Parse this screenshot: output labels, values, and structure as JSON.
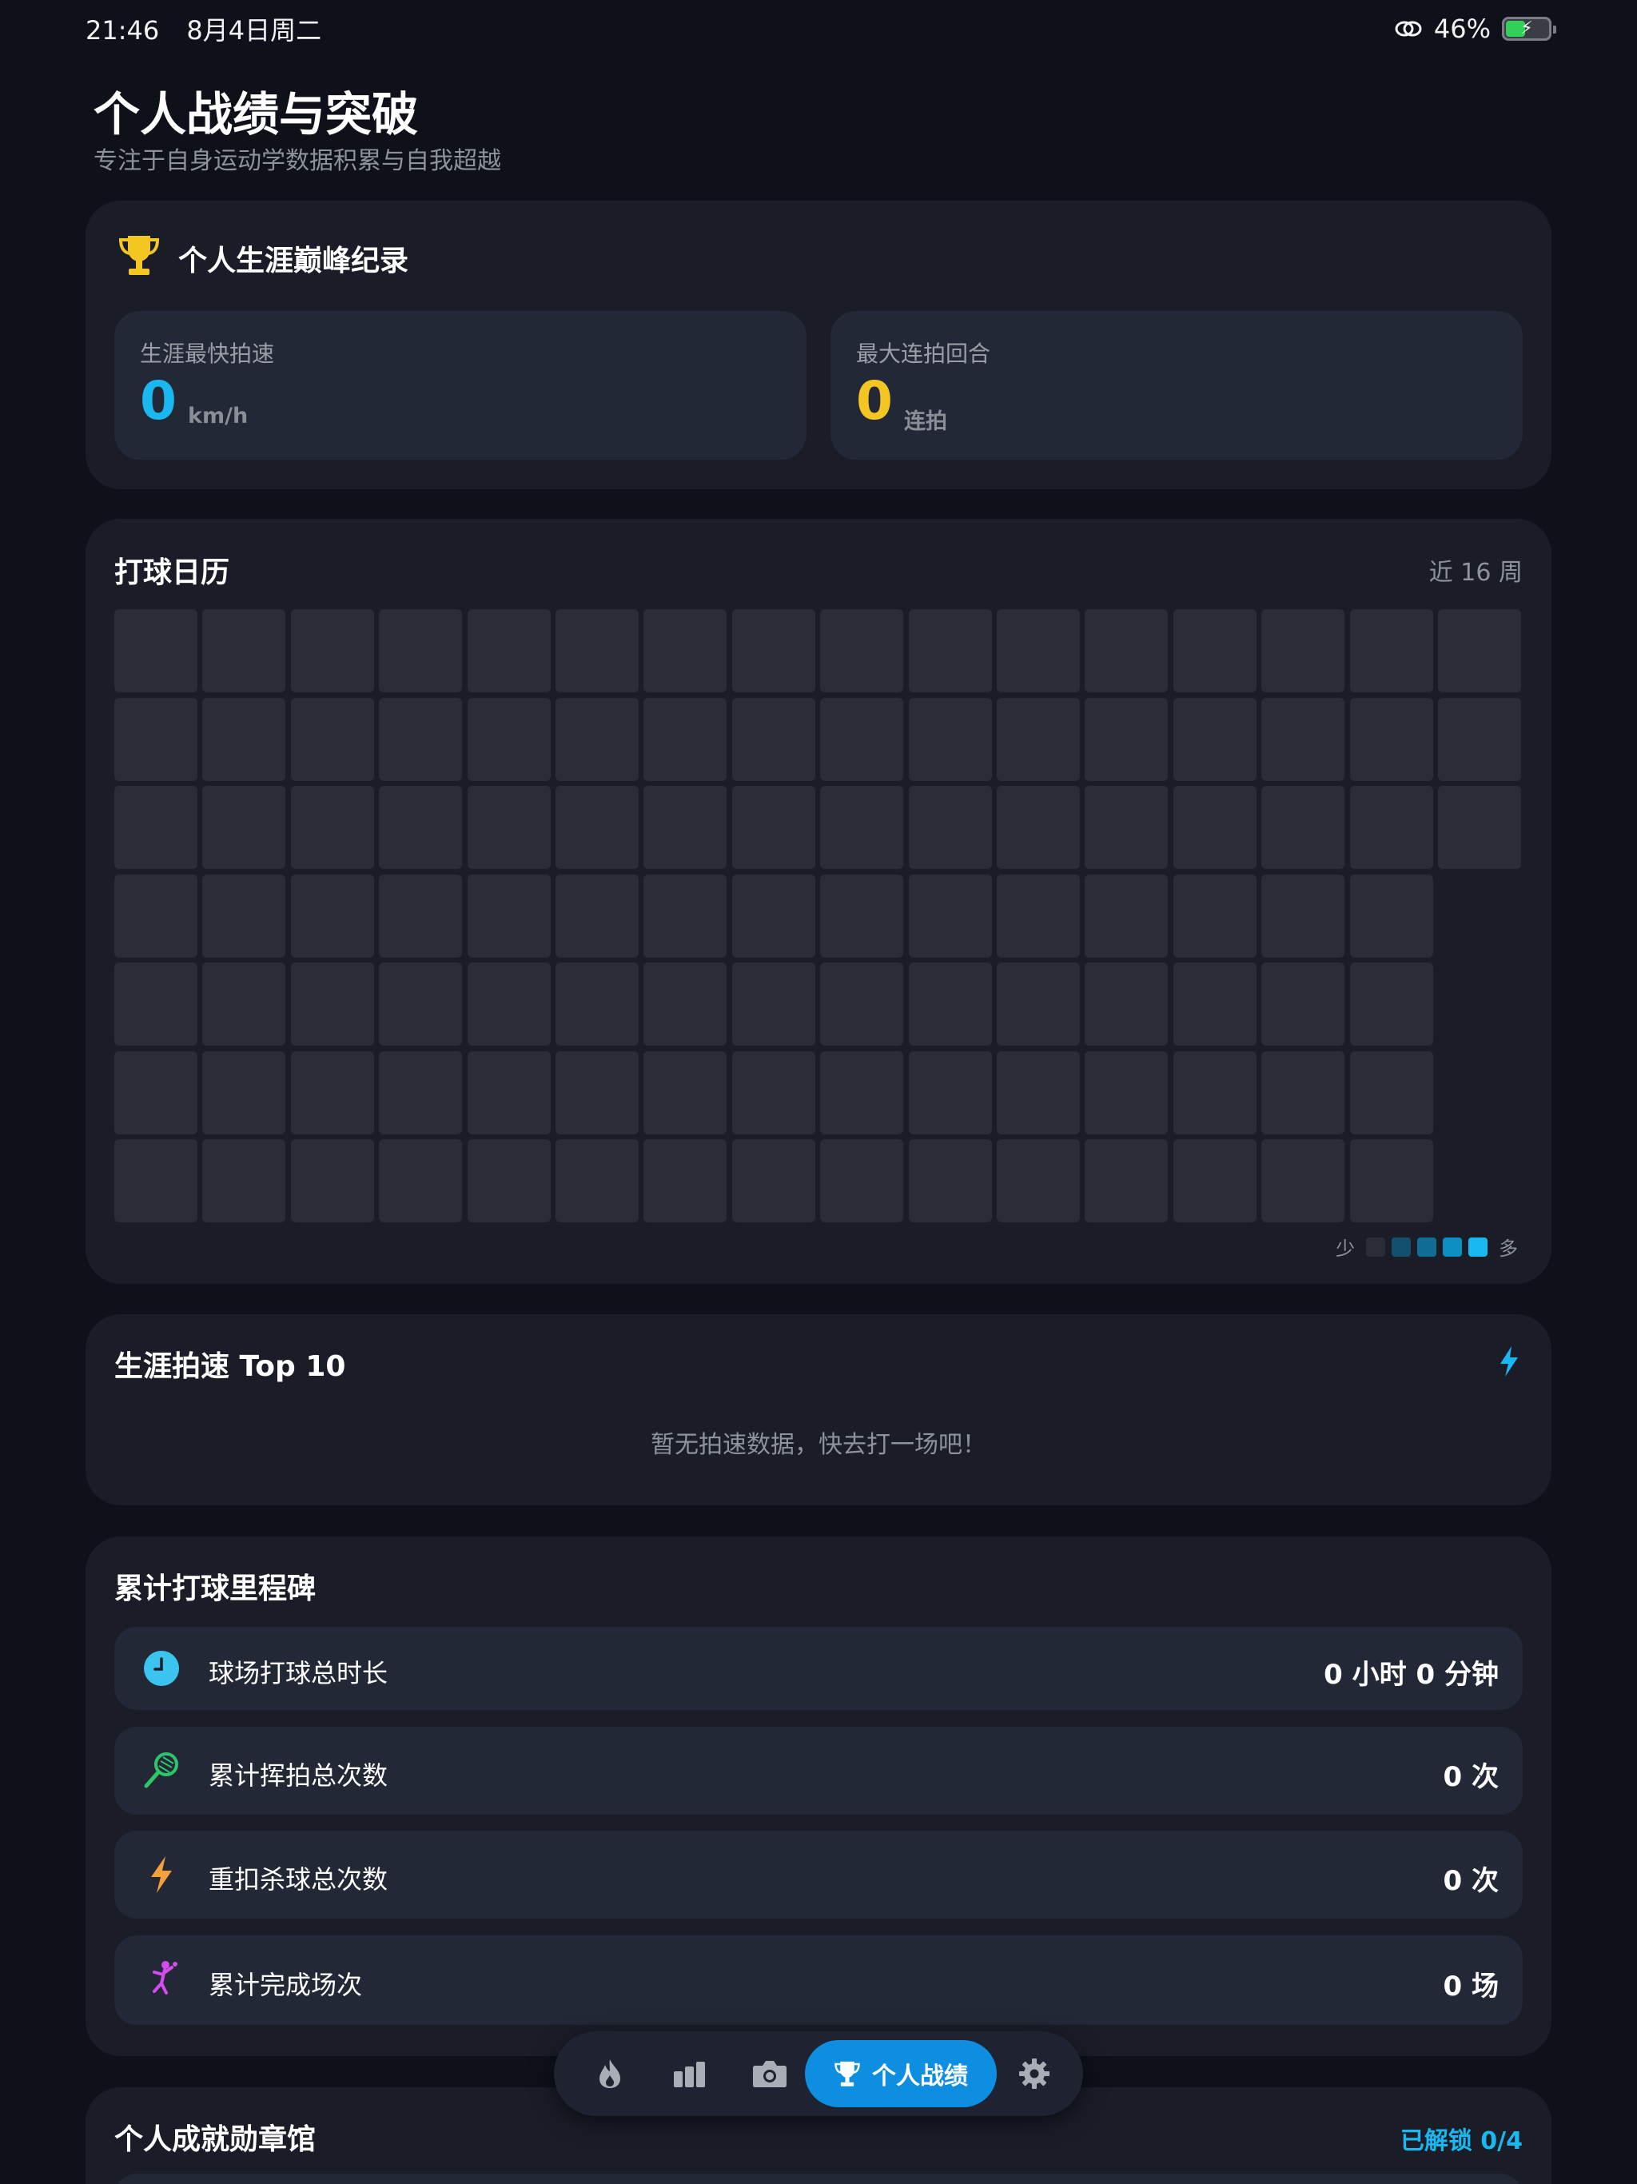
{
  "status_bar": {
    "time": "21:46",
    "date": "8月4日周二",
    "battery_percent": "46%",
    "battery_level": 0.46
  },
  "header": {
    "title": "个人战绩与突破",
    "subtitle": "专注于自身运动学数据积累与自我超越"
  },
  "peak": {
    "title": "个人生涯巅峰纪录",
    "icon": "trophy-icon",
    "fastest_label": "生涯最快拍速",
    "fastest_value": "0",
    "fastest_unit": "km/h",
    "rally_label": "最大连拍回合",
    "rally_value": "0",
    "rally_unit": "连拍",
    "colors": {
      "speed": "#19b8f0",
      "rally": "#f4c622"
    }
  },
  "calendar": {
    "title": "打球日历",
    "range": "近 16 周",
    "weeks": 16,
    "days_per_week": 7,
    "last_week_days": 3,
    "legend_less": "少",
    "legend_more": "多",
    "legend_colors": [
      "#2a2d37",
      "#12506e",
      "#0f6d96",
      "#0d8fc4",
      "#19b8f0"
    ]
  },
  "top10": {
    "title": "生涯拍速 Top 10",
    "icon": "lightning-icon",
    "empty_text": "暂无拍速数据，快去打一场吧！"
  },
  "milestones": {
    "title": "累计打球里程碑",
    "items": [
      {
        "icon": "clock-icon",
        "label": "球场打球总时长",
        "value": "0 小时 0 分钟"
      },
      {
        "icon": "racket-icon",
        "label": "累计挥拍总次数",
        "value": "0 次"
      },
      {
        "icon": "lightning-icon",
        "label": "重扣杀球总次数",
        "value": "0 次"
      },
      {
        "icon": "player-icon",
        "label": "累计完成场次",
        "value": "0 场"
      }
    ]
  },
  "badges": {
    "title": "个人成就勋章馆",
    "unlocked": "已解锁 0/4"
  },
  "tab_bar": {
    "tabs": [
      {
        "icon": "flame-icon"
      },
      {
        "icon": "bar-chart-icon"
      },
      {
        "icon": "camera-icon"
      },
      {
        "icon": "trophy-icon",
        "label": "个人战绩",
        "active": true
      },
      {
        "icon": "gear-icon"
      }
    ]
  }
}
